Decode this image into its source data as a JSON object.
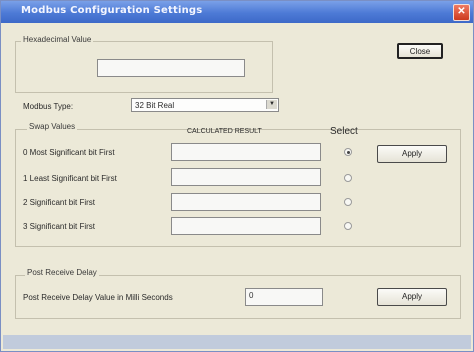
{
  "window": {
    "title": "Modbus Configuration Settings",
    "close_glyph": "✕"
  },
  "hex": {
    "group_label": "Hexadecimal Value",
    "value": "",
    "close_button": "Close"
  },
  "modbus_type": {
    "label": "Modbus Type:",
    "selected": "32 Bit Real",
    "arrow": "▼"
  },
  "swap": {
    "group_label": "Swap Values",
    "result_header": "CALCULATED RESULT",
    "select_header": "Select",
    "apply_button": "Apply",
    "rows": [
      {
        "label": "0 Most Significant bit First",
        "value": "",
        "selected": true
      },
      {
        "label": "1 Least Significant bit First",
        "value": "",
        "selected": false
      },
      {
        "label": "2  Significant bit First",
        "value": "",
        "selected": false
      },
      {
        "label": "3  Significant bit First",
        "value": "",
        "selected": false
      }
    ]
  },
  "delay": {
    "group_label": "Post Receive Delay",
    "field_label": "Post Receive Delay Value in Milli Seconds",
    "value": "0",
    "apply_button": "Apply"
  }
}
